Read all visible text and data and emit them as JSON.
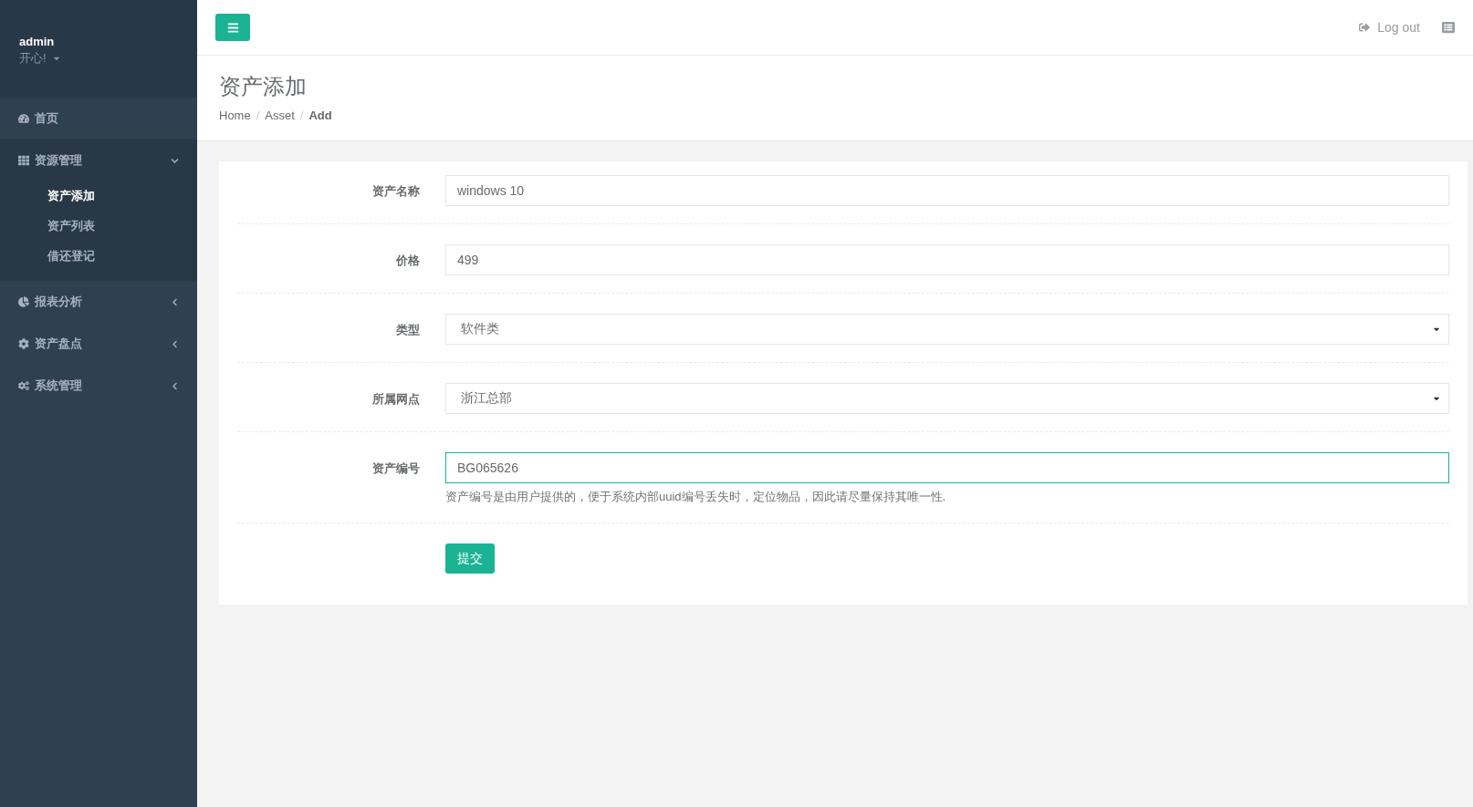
{
  "sidebar": {
    "user": {
      "name": "admin",
      "status": "开心!"
    },
    "menu": [
      {
        "kind": "link",
        "label": "首页"
      },
      {
        "kind": "group",
        "label": "资源管理",
        "expanded": true,
        "children": [
          {
            "label": "资产添加",
            "selected": true
          },
          {
            "label": "资产列表",
            "selected": false
          },
          {
            "label": "借还登记",
            "selected": false
          }
        ]
      },
      {
        "kind": "group",
        "label": "报表分析",
        "expanded": false
      },
      {
        "kind": "group",
        "label": "资产盘点",
        "expanded": false
      },
      {
        "kind": "group",
        "label": "系统管理",
        "expanded": false
      }
    ]
  },
  "topbar": {
    "logout": "Log out"
  },
  "page": {
    "title": "资产添加",
    "separator": "/",
    "breadcrumb": [
      {
        "label": "Home",
        "selected": false
      },
      {
        "label": "Asset",
        "selected": false
      },
      {
        "label": "Add",
        "selected": true
      }
    ]
  },
  "form": {
    "fields": [
      {
        "kind": "text",
        "label": "资产名称",
        "value": "windows 10",
        "focused": false
      },
      {
        "kind": "text",
        "label": "价格",
        "value": "499",
        "focused": false
      },
      {
        "kind": "select",
        "label": "类型",
        "value": "软件类",
        "focused": false
      },
      {
        "kind": "select",
        "label": "所属网点",
        "value": "浙江总部",
        "focused": false
      },
      {
        "kind": "text",
        "label": "资产编号",
        "value": "BG065626",
        "focused": true,
        "help": "资产编号是由用户提供的，便于系统内部uuid编号丢失时，定位物品，因此请尽量保持其唯一性."
      }
    ],
    "submit": "提交"
  }
}
